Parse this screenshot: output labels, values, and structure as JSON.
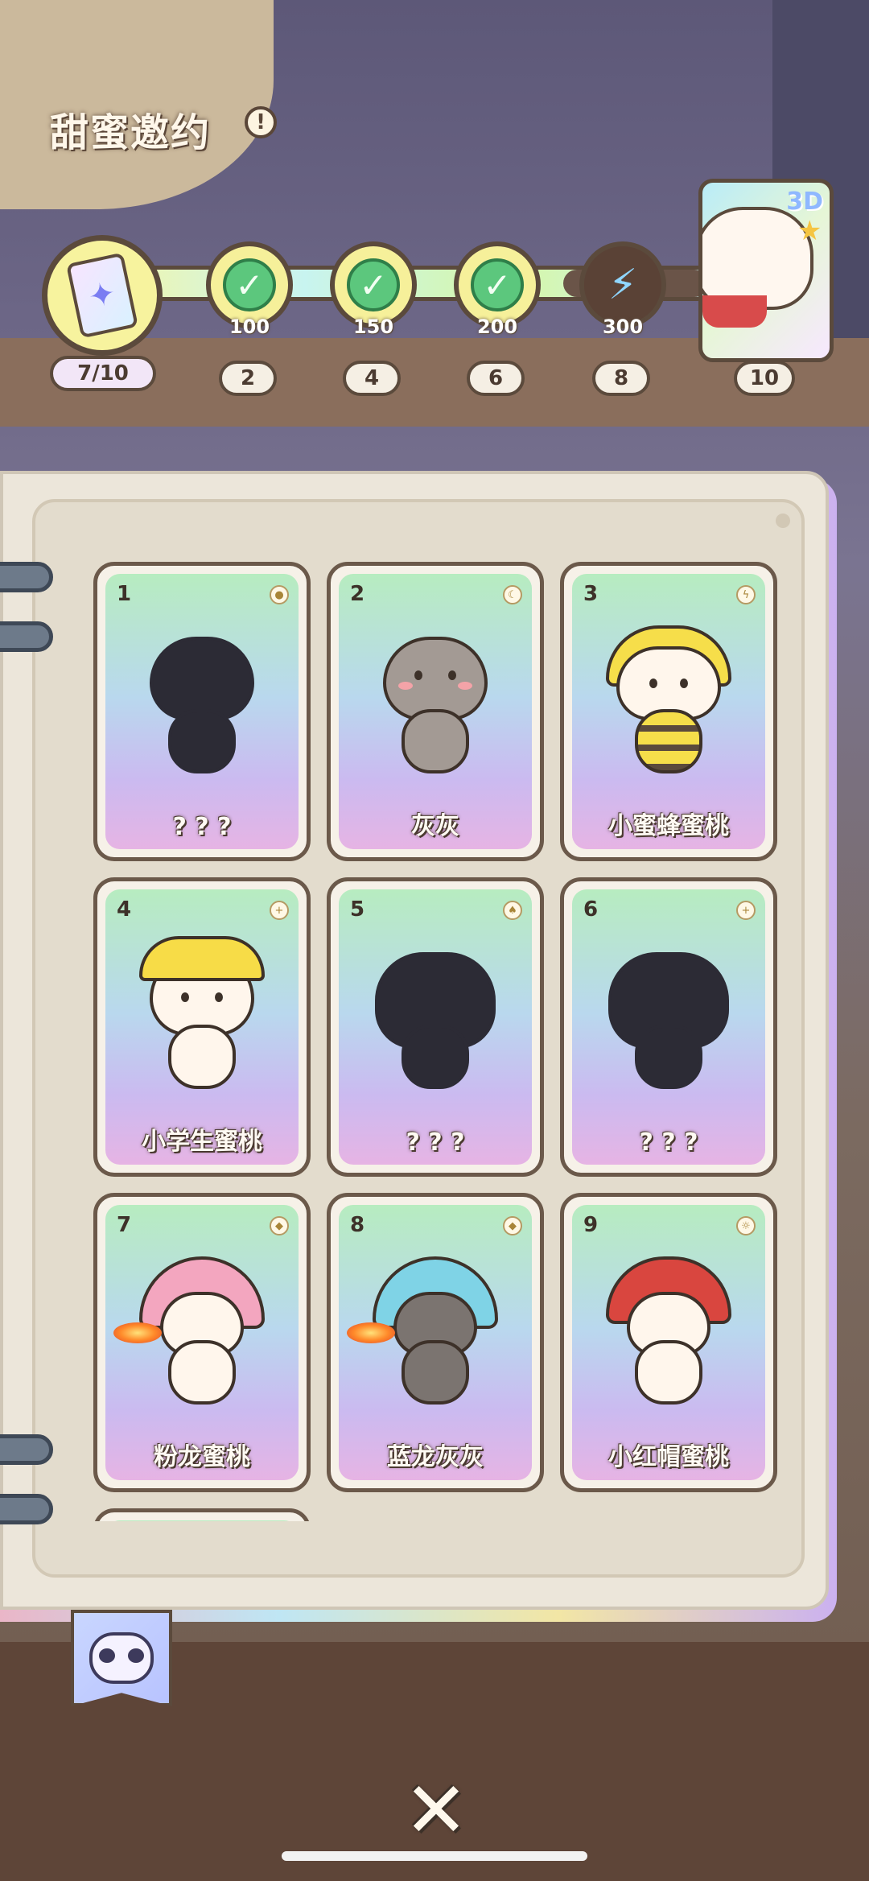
{
  "header": {
    "title": "甜蜜邀约",
    "help_icon": "!"
  },
  "progress": {
    "current_label": "7/10",
    "nodes": [
      {
        "value": "100",
        "milestone": "2",
        "claimed": true
      },
      {
        "value": "150",
        "milestone": "4",
        "claimed": true
      },
      {
        "value": "200",
        "milestone": "6",
        "claimed": true
      },
      {
        "value": "300",
        "milestone": "8",
        "claimed": false
      }
    ],
    "final_reward": {
      "badge": "3D",
      "milestone": "10"
    }
  },
  "cards": [
    {
      "number": "1",
      "name": "? ? ?"
    },
    {
      "number": "2",
      "name": "灰灰"
    },
    {
      "number": "3",
      "name": "小蜜蜂蜜桃"
    },
    {
      "number": "4",
      "name": "小学生蜜桃"
    },
    {
      "number": "5",
      "name": "? ? ?"
    },
    {
      "number": "6",
      "name": "? ? ?"
    },
    {
      "number": "7",
      "name": "粉龙蜜桃"
    },
    {
      "number": "8",
      "name": "蓝龙灰灰"
    },
    {
      "number": "9",
      "name": "小红帽蜜桃"
    }
  ],
  "colors": {
    "outline": "#5b4a3c",
    "check_green": "#5cc77d",
    "node_yellow": "#f6f09a"
  }
}
